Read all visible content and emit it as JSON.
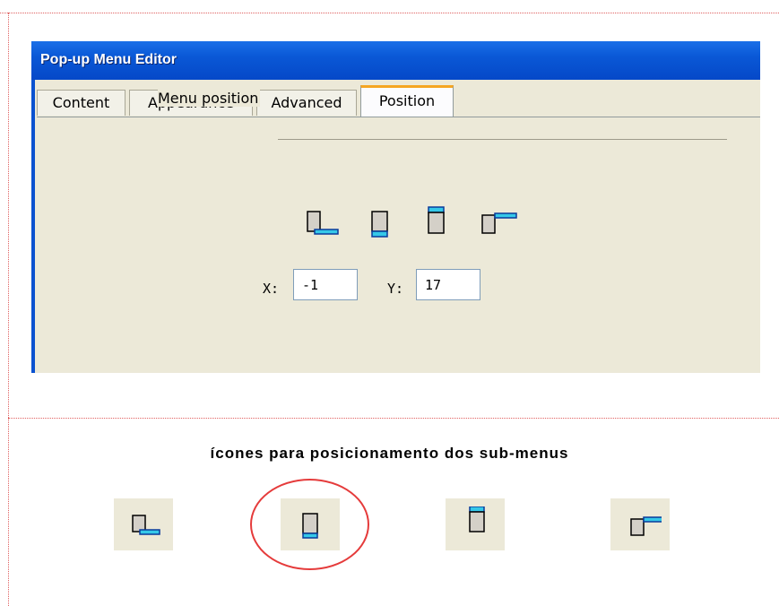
{
  "window": {
    "title": "Pop-up Menu Editor"
  },
  "tabs": [
    {
      "label": "Content",
      "active": false
    },
    {
      "label": "Appearance",
      "active": false
    },
    {
      "label": "Advanced",
      "active": false
    },
    {
      "label": "Position",
      "active": true
    }
  ],
  "position_group": {
    "label": "Menu position",
    "icons": [
      "submenu-below-left-icon",
      "submenu-below-icon",
      "submenu-above-icon",
      "submenu-right-top-icon"
    ]
  },
  "offset": {
    "x_label": "X:",
    "x_value": "-1",
    "y_label": "Y:",
    "y_value": "17"
  },
  "caption": "ícones para posicionamento dos sub-menus",
  "highlighted_icon": "submenu-below-icon",
  "colors": {
    "title_bar": "#0a58d6",
    "dialog_bg": "#ece9d8",
    "highlight": "#e53b3b",
    "submenu": "#35c8e8",
    "tab_accent": "#f5a623"
  }
}
